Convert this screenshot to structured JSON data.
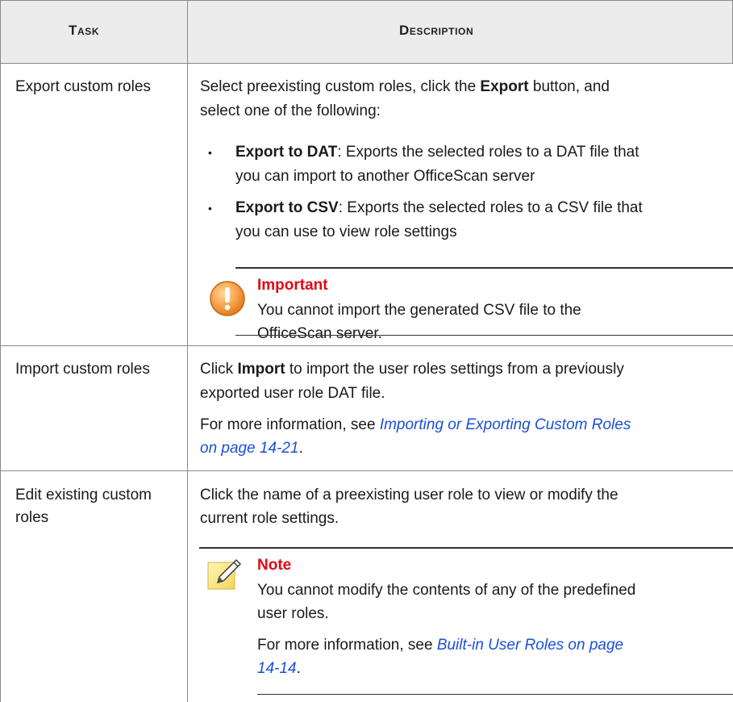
{
  "table": {
    "headers": [
      "Task",
      "Description"
    ],
    "rows": [
      {
        "task": "Export custom roles",
        "desc_intro_a": "Select preexisting custom roles, click the ",
        "desc_intro_b": "Export",
        "desc_intro_c": " button, and",
        "desc_intro_line2": "select one of the following:",
        "bullets": [
          {
            "term": "Export to DAT",
            "line1": ": Exports the selected roles to a DAT file that",
            "line2": "you can import to another OfficeScan server"
          },
          {
            "term": "Export to CSV",
            "line1": ": Exports the selected roles to a CSV file that",
            "line2": "you can use to view role settings"
          }
        ],
        "admonition": {
          "title": "Important",
          "line1": "You cannot import the generated CSV file to the",
          "line2": "OfficeScan server."
        }
      },
      {
        "task": "Import custom roles",
        "line1_a": "Click ",
        "line1_b": "Import",
        "line1_c": " to import the user roles settings from a previously",
        "line2": "exported user role DAT file.",
        "more_prefix": "For more information, see ",
        "link_line1": "Importing or Exporting Custom Roles",
        "link_line2": "on page 14-21",
        "period": "."
      },
      {
        "task_line1": "Edit existing custom",
        "task_line2": "roles",
        "line1": "Click the name of a preexisting user role to view or modify the",
        "line2": "current role settings.",
        "note": {
          "title": "Note",
          "line1": "You cannot modify the contents of any of the predefined",
          "line2": "user roles.",
          "more_prefix": "For more information, see ",
          "link_line1": "Built-in User Roles on page",
          "link_line2": "14-14",
          "period": "."
        }
      }
    ]
  },
  "colors": {
    "link": "#1a4fd6",
    "admonition_title": "#e30613",
    "header_bg": "#ececec"
  }
}
